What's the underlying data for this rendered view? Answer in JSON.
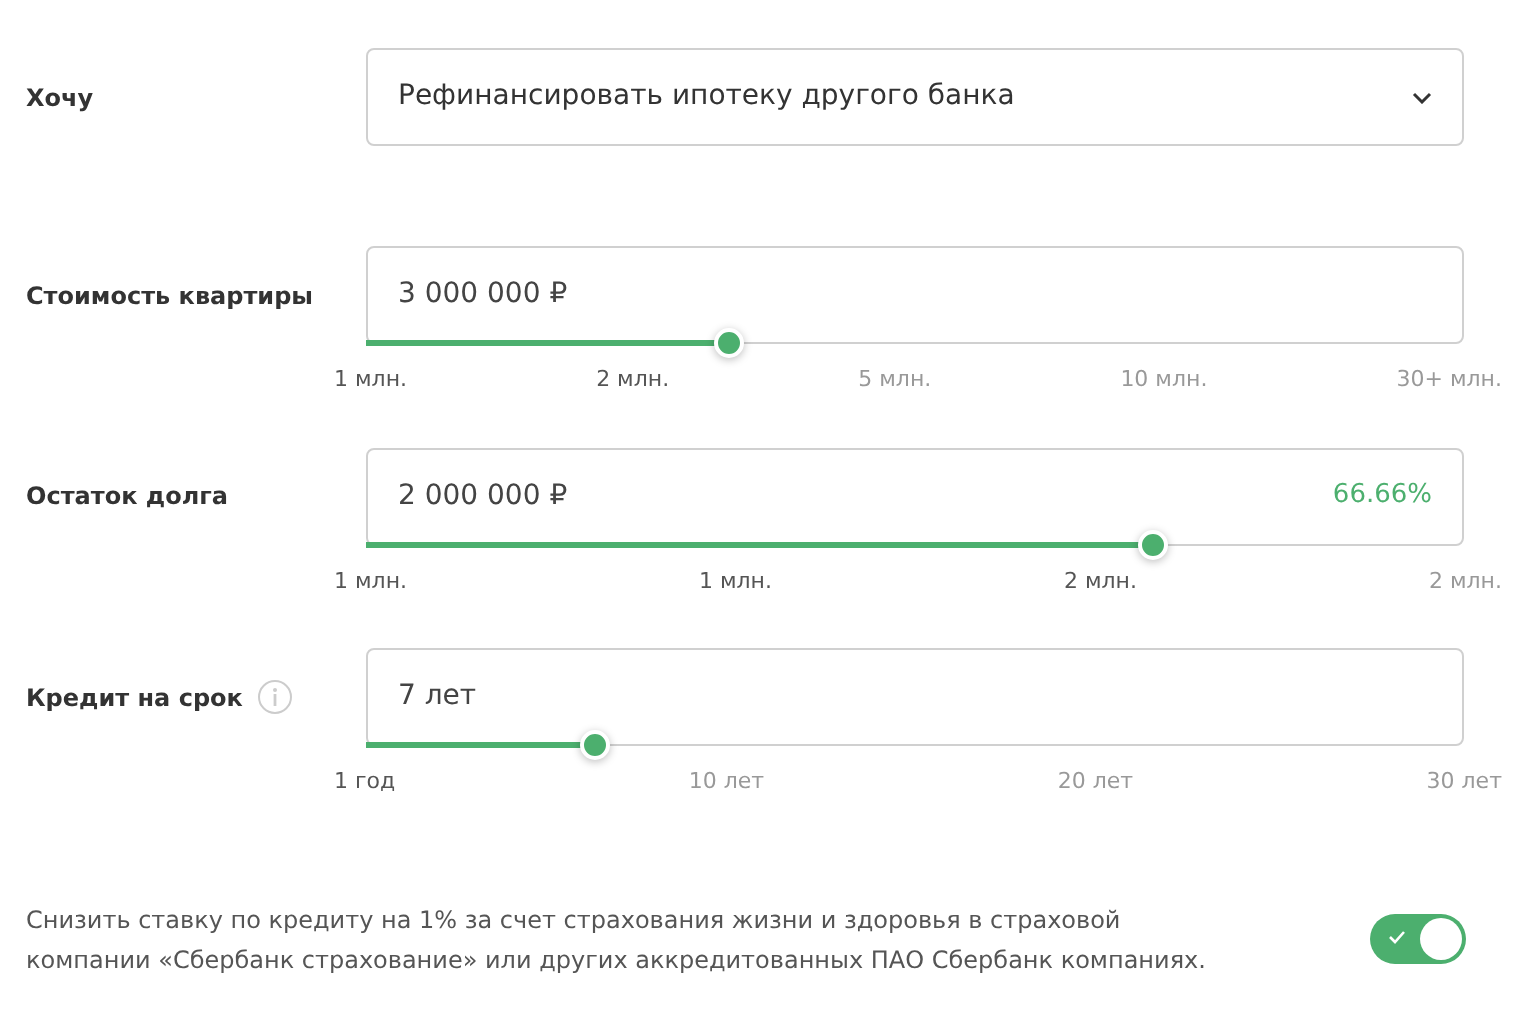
{
  "purpose": {
    "label": "Хочу",
    "value": "Рефинансировать ипотеку другого банка"
  },
  "sliders": [
    {
      "label": "Стоимость квартиры",
      "value": "3 000 000 ₽",
      "level": 0.33,
      "info": false,
      "ticks": [
        {
          "label": "1 млн.",
          "highlighted": true
        },
        {
          "label": "2 млн.",
          "highlighted": true
        },
        {
          "label": "5 млн.",
          "highlighted": false
        },
        {
          "label": "10 млн.",
          "highlighted": false
        },
        {
          "label": "30+ млн.",
          "highlighted": false
        }
      ]
    },
    {
      "label": "Остаток долга",
      "value": "2 000 000 ₽",
      "percent": "66.66%",
      "level": 0.716,
      "info": false,
      "ticks": [
        {
          "label": "1 млн.",
          "highlighted": true
        },
        {
          "label": "1 млн.",
          "highlighted": true
        },
        {
          "label": "2 млн.",
          "highlighted": true
        },
        {
          "label": "2 млн.",
          "highlighted": false
        }
      ]
    },
    {
      "label": "Кредит на срок",
      "value": "7 лет",
      "level": 0.208,
      "info": true,
      "ticks": [
        {
          "label": "1 год",
          "highlighted": true
        },
        {
          "label": "10 лет",
          "highlighted": false
        },
        {
          "label": "20 лет",
          "highlighted": false
        },
        {
          "label": "30 лет",
          "highlighted": false
        }
      ]
    }
  ],
  "insurance": {
    "text": "Снизить ставку по кредиту на 1% за счет страхования жизни и здоровья в страховой компании «Сбербанк страхование» или других аккредитованных ПАО Сбербанк компаниях.",
    "on": true
  }
}
